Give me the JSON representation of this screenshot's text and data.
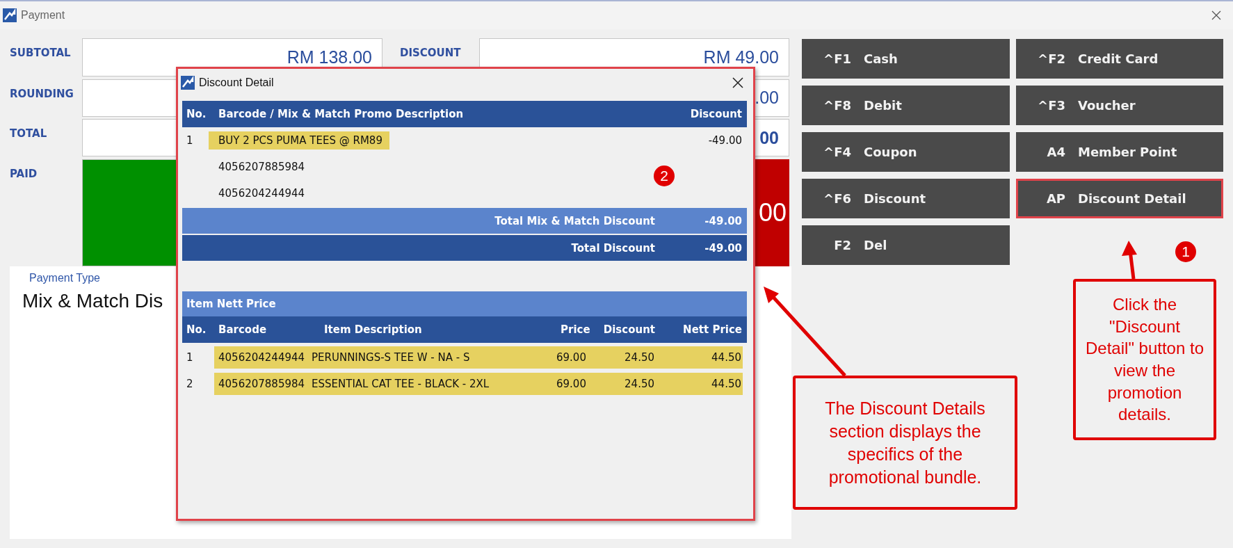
{
  "window": {
    "title": "Payment"
  },
  "amounts_left": [
    {
      "label": "SUBTOTAL",
      "value": "RM 138.00"
    },
    {
      "label": "ROUNDING"
    },
    {
      "label": "TOTAL"
    }
  ],
  "amounts_right": [
    {
      "label": "DISCOUNT",
      "value": "RM 49.00",
      "bold": false
    },
    {
      "value": ".00",
      "bold": false
    },
    {
      "value": "00",
      "bold": true
    }
  ],
  "paid": {
    "label": "PAID",
    "change_value": "00"
  },
  "payment_type": {
    "label": "Payment Type",
    "value": "Mix & Match Dis"
  },
  "payment_buttons": [
    {
      "key": "^F1",
      "label": "Cash",
      "highlighted": false
    },
    {
      "key": "^F2",
      "label": "Credit Card",
      "highlighted": false
    },
    {
      "key": "^F8",
      "label": "Debit",
      "highlighted": false
    },
    {
      "key": "^F3",
      "label": "Voucher",
      "highlighted": false
    },
    {
      "key": "^F4",
      "label": "Coupon",
      "highlighted": false
    },
    {
      "key": "A4",
      "label": "Member Point",
      "highlighted": false
    },
    {
      "key": "^F6",
      "label": "Discount",
      "highlighted": false
    },
    {
      "key": "AP",
      "label": "Discount Detail",
      "highlighted": true
    },
    {
      "key": "F2",
      "label": "Del",
      "highlighted": false
    }
  ],
  "dialog": {
    "title": "Discount Detail",
    "highlighted": true,
    "promo_table": {
      "columns": [
        "No.",
        "Barcode / Mix & Match Promo Description",
        "Discount"
      ],
      "rows": [
        {
          "no": "1",
          "description": "BUY 2 PCS PUMA TEES @ RM89",
          "discount": "-49.00",
          "highlighted": true
        },
        {
          "description": "4056207885984",
          "highlighted": false
        },
        {
          "description": "4056204244944",
          "highlighted": false
        }
      ],
      "totals": [
        {
          "kind": "subtotal",
          "label": "Total Mix & Match Discount",
          "value": "-49.00"
        },
        {
          "kind": "total",
          "label": "Total Discount",
          "value": "-49.00"
        }
      ]
    },
    "item_table": {
      "title": "Item Nett Price",
      "columns": [
        "No.",
        "Barcode",
        "Item Description",
        "Price",
        "Discount",
        "Nett Price"
      ],
      "rows": [
        {
          "cells": [
            "1",
            "4056204244944",
            "PERUNNINGS-S TEE W - NA - S",
            "69.00",
            "24.50",
            "44.50"
          ],
          "highlighted": true
        },
        {
          "cells": [
            "2",
            "4056207885984",
            "ESSENTIAL CAT TEE - BLACK - 2XL",
            "69.00",
            "24.50",
            "44.50"
          ],
          "highlighted": true
        }
      ]
    }
  },
  "annotations": [
    {
      "number": "2",
      "text": "The Discount Details section displays the specifics of the promotional bundle."
    },
    {
      "number": "1",
      "text": "Click the \"Discount Detail\" button to view the promotion details."
    }
  ]
}
